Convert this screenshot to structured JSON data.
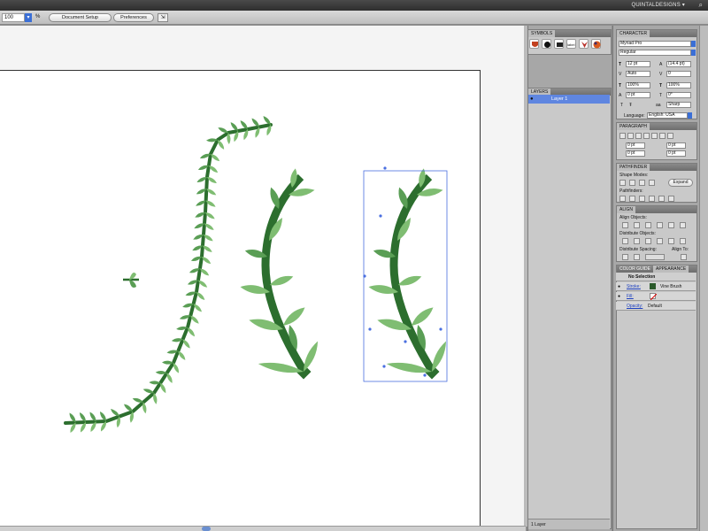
{
  "menubar": {
    "user": "QUINTALDESIGNS",
    "user_arrow": "▾",
    "search_icon": "search-icon"
  },
  "control_bar": {
    "zoom_value": "100",
    "zoom_unit": "%",
    "document_setup": "Document Setup",
    "preferences": "Preferences",
    "arrange_icon": "arrange-documents-icon"
  },
  "symbols_panel": {
    "tab": "SYMBOLS",
    "symbols": [
      {
        "name": "shield",
        "color": "#c2401f"
      },
      {
        "name": "splat",
        "color": "#111111"
      },
      {
        "name": "tag",
        "color": "#222222"
      },
      {
        "name": "label",
        "color": "#444444",
        "text": "label"
      },
      {
        "name": "fox",
        "color": "#b8302a"
      },
      {
        "name": "ball",
        "color": "#d95a1e"
      }
    ]
  },
  "layers_panel": {
    "tab": "LAYERS",
    "layer_name": "Layer 1",
    "footer": "1 Layer"
  },
  "character_panel": {
    "tab": "CHARACTER",
    "font_family": "Myriad Pro",
    "font_style": "Regular",
    "font_size": "12 pt",
    "leading": "(14.4 pt)",
    "kerning": "Auto",
    "tracking": "0",
    "vscale": "100%",
    "hscale": "100%",
    "baseline": "0 pt",
    "rotation": "0°",
    "antialias": "Sharp",
    "language_label": "Language:",
    "language": "English: USA"
  },
  "paragraph_panel": {
    "tab": "PARAGRAPH",
    "indent_left": "0 pt",
    "indent_right": "0 pt",
    "first_line": "0 pt",
    "space_before": "0 pt"
  },
  "pathfinder_panel": {
    "tab": "PATHFINDER",
    "shape_modes": "Shape Modes:",
    "expand": "Expand",
    "pathfinders": "Pathfinders:"
  },
  "align_panel": {
    "tab": "ALIGN",
    "align_objects": "Align Objects:",
    "distribute_objects": "Distribute Objects:",
    "distribute_spacing": "Distribute Spacing:",
    "align_to": "Align To:"
  },
  "appearance_panel": {
    "tabs": [
      "COLOR GUIDE",
      "APPEARANCE"
    ],
    "selection": "No Selection",
    "rows": [
      {
        "label": "Stroke:",
        "value": "Vine Brush",
        "swatch": "#2a5a2a"
      },
      {
        "label": "Fill:",
        "value": "",
        "swatch": "none"
      },
      {
        "label": "Opacity:",
        "value": "Default",
        "swatch": ""
      }
    ]
  },
  "colors": {
    "vine_dark": "#2c6e2e",
    "leaf_mid": "#5a9e55",
    "leaf_light": "#7fbd72",
    "selection_blue": "#4a6fe0"
  }
}
